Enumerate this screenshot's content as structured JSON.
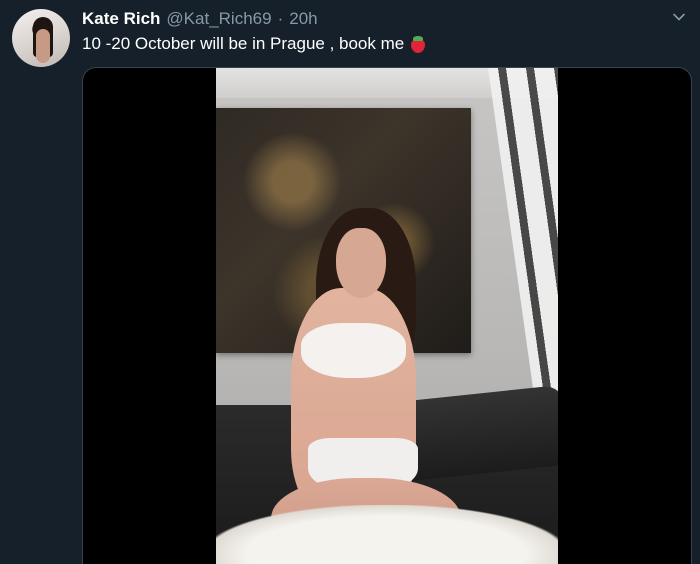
{
  "tweet": {
    "author_name": "Kate Rich",
    "author_handle": "@Kat_Rich69",
    "separator": "·",
    "timestamp": "20h",
    "text": "10 -20 October will be in Prague , book me",
    "emoji": "strawberry-emoji",
    "avatar": "profile-photo",
    "menu_icon": "chevron-down-icon",
    "media": {
      "type": "video",
      "description_icon": "video-thumbnail"
    }
  },
  "colors": {
    "background": "#15202b",
    "name": "#ffffff",
    "secondary_text": "#8899a6",
    "media_border": "#38444d",
    "emoji": "#e0253a"
  }
}
